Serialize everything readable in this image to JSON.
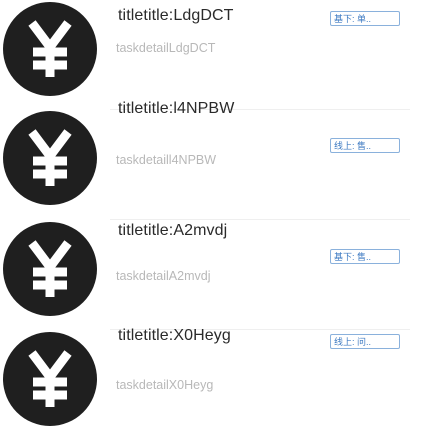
{
  "tasks": [
    {
      "title": "titletitle:LdgDCT",
      "detail": "taskdetailLdgDCT",
      "tag": "基下: 单..",
      "icon": "yen-icon"
    },
    {
      "title": "titletitle:l4NPBW",
      "detail": "taskdetaill4NPBW",
      "tag": "线上: 售..",
      "icon": "yen-icon"
    },
    {
      "title": "titletitle:A2mvdj",
      "detail": "taskdetailA2mvdj",
      "tag": "基下: 售..",
      "icon": "yen-icon"
    },
    {
      "title": "titletitle:X0Heyg",
      "detail": "taskdetailX0Heyg",
      "tag": "线上: 问..",
      "icon": "yen-icon"
    }
  ]
}
